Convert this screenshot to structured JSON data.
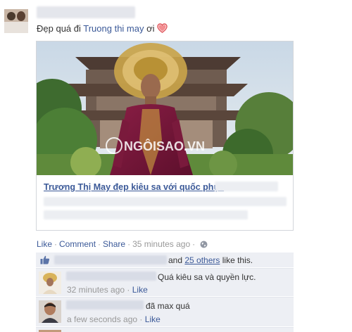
{
  "status": {
    "text_before": "Đẹp quá đi ",
    "tagged_name": "Truong thi may",
    "text_after": " ơi "
  },
  "share_card": {
    "title": "Trương Thị May đẹp kiêu sa với quốc phục",
    "watermark": "NGÔISAO.VN"
  },
  "actions": {
    "like": "Like",
    "comment": "Comment",
    "share": "Share",
    "dot": "·",
    "time": "35 minutes ago"
  },
  "likes": {
    "and": "and ",
    "others": "25 others",
    "suffix": " like this."
  },
  "comments": [
    {
      "text": "Quá kiêu sa và quyền lực.",
      "time": "32 minutes ago",
      "dot": "·",
      "like": "Like"
    },
    {
      "text": "đã max quá",
      "time": "a few seconds ago",
      "dot": "·",
      "like": "Like"
    }
  ],
  "colors": {
    "link": "#3b5998",
    "comment_bg": "#edeff4",
    "heart": "#e0565b"
  }
}
